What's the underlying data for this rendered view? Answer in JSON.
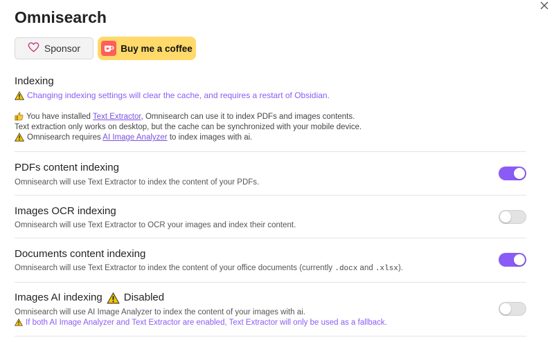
{
  "title": "Omnisearch",
  "buttons": {
    "sponsor": "Sponsor",
    "coffee": "Buy me a coffee"
  },
  "indexing": {
    "heading": "Indexing",
    "warning": "Changing indexing settings will clear the cache, and requires a restart of Obsidian.",
    "info_prefix": "You have installed ",
    "text_extractor_link": "Text Extractor",
    "info_suffix": ", Omnisearch can use it to index PDFs and images contents.",
    "info_line2": "Text extraction only works on desktop, but the cache can be synchronized with your mobile device.",
    "ai_prefix": "Omnisearch requires ",
    "ai_link": "AI Image Analyzer",
    "ai_suffix": " to index images with ai."
  },
  "settings": [
    {
      "name": "PDFs content indexing",
      "desc": "Omnisearch will use Text Extractor to index the content of your PDFs.",
      "enabled": true
    },
    {
      "name": "Images OCR indexing",
      "desc": "Omnisearch will use Text Extractor to OCR your images and index their content.",
      "enabled": false
    },
    {
      "name": "Documents content indexing",
      "desc_prefix": "Omnisearch will use Text Extractor to index the content of your office documents (currently ",
      "code1": ".docx",
      "and": " and ",
      "code2": ".xlsx",
      "desc_suffix": ").",
      "enabled": true
    },
    {
      "name": "Images AI indexing",
      "status": "Disabled",
      "desc": "Omnisearch will use AI Image Analyzer to index the content of your images with ai.",
      "note": "If both AI Image Analyzer and Text Extractor are enabled, Text Extractor will only be used as a fallback.",
      "enabled": false
    }
  ],
  "colors": {
    "accent": "#8a5cf5",
    "coffee": "#ffd96a",
    "sponsor_heart": "#c5377a"
  },
  "icons": {
    "close": "close-icon",
    "heart": "heart-icon",
    "coffee": "coffee-cup-icon",
    "warning": "warning-icon",
    "thumbs_up": "thumbs-up-icon"
  }
}
